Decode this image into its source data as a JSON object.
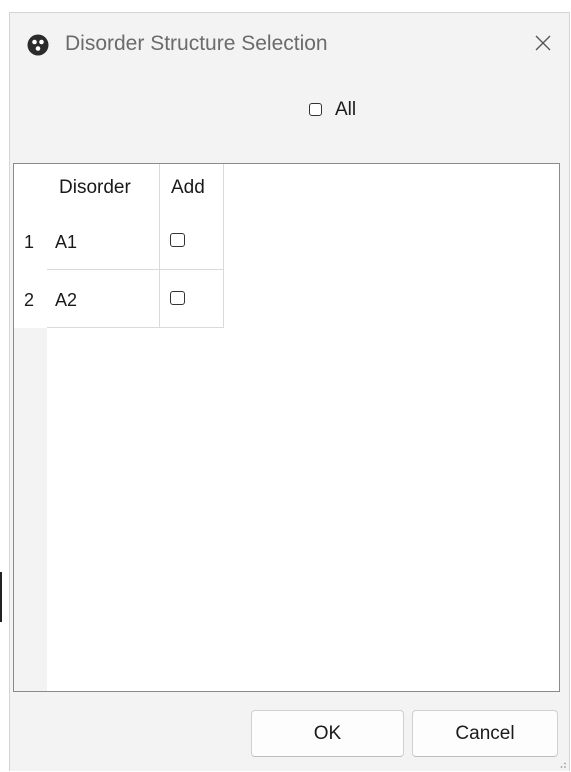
{
  "window": {
    "title": "Disorder Structure Selection",
    "icon": "app-logo-icon",
    "close_icon": "close-icon"
  },
  "select_all": {
    "label": "All",
    "checked": false
  },
  "table": {
    "columns": [
      "Disorder",
      "Add"
    ],
    "rows": [
      {
        "index": "1",
        "disorder": "A1",
        "add": false
      },
      {
        "index": "2",
        "disorder": "A2",
        "add": false
      }
    ]
  },
  "buttons": {
    "ok_label": "OK",
    "cancel_label": "Cancel"
  },
  "colors": {
    "window_bg": "#f3f3f3",
    "title_text": "#6b6b6b",
    "table_bg": "#ffffff"
  }
}
